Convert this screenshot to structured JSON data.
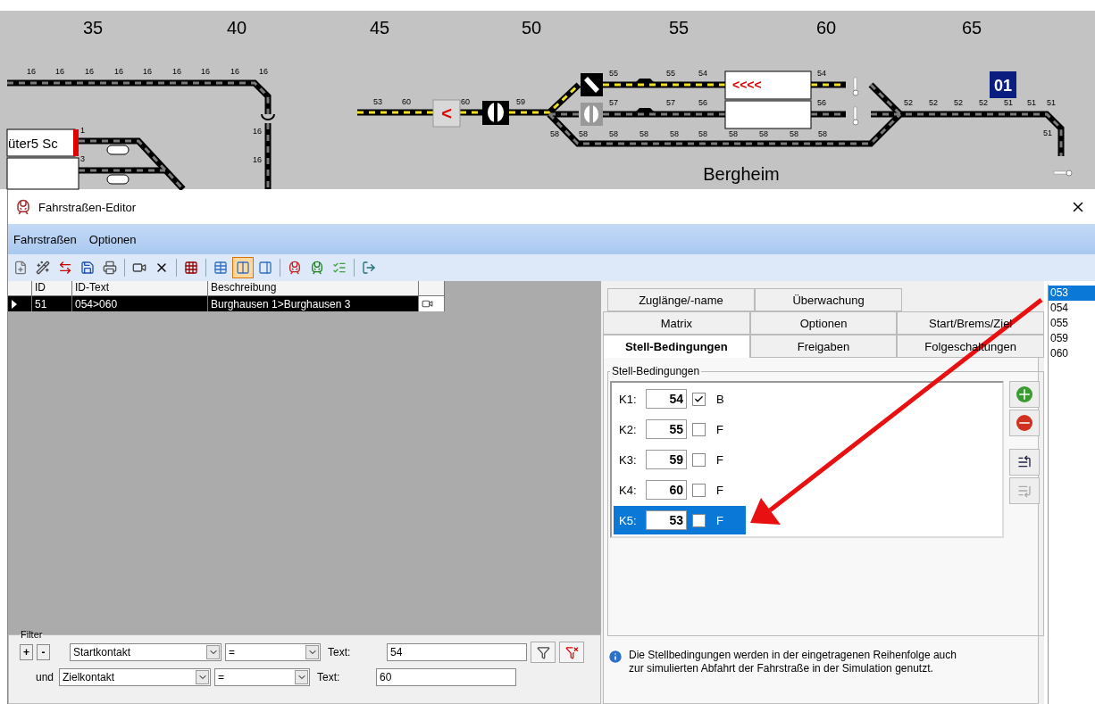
{
  "layout": {
    "column_numbers": [
      "35",
      "40",
      "45",
      "50",
      "55",
      "60",
      "65"
    ],
    "track_labels": [
      "16",
      "16",
      "16",
      "16",
      "16",
      "16",
      "16",
      "16",
      "16",
      "16",
      "16",
      "1",
      "3",
      "53",
      "60",
      "60",
      "59",
      "55",
      "55",
      "54",
      "54",
      "57",
      "57",
      "56",
      "56",
      "58",
      "58",
      "58",
      "58",
      "58",
      "58",
      "58",
      "58",
      "58",
      "58",
      "52",
      "52",
      "52",
      "52",
      "51",
      "51",
      "51",
      "51"
    ],
    "block_label": "üter5 Sc",
    "signal_button": "<",
    "route_arrows": "<<<<",
    "route_badge": "01",
    "station_name": "Bergheim"
  },
  "window": {
    "title": "Fahrstraßen-Editor"
  },
  "menu": [
    "Fahrstraßen",
    "Optionen"
  ],
  "toolbar": {
    "view_modes": [
      {
        "selected": false
      },
      {
        "selected": true
      },
      {
        "selected": false
      }
    ]
  },
  "table": {
    "columns": [
      "ID",
      "ID-Text",
      "Beschreibung"
    ],
    "rows": [
      {
        "id": "51",
        "id_text": "054>060",
        "description": "Burghausen 1>Burghausen 3",
        "selected": true
      }
    ]
  },
  "filter": {
    "title": "Filter",
    "rows": [
      {
        "kind": "first",
        "add": "+",
        "remove": "-",
        "field": "Startkontakt",
        "operator": "=",
        "text_label": "Text:",
        "value": "54"
      },
      {
        "kind": "and",
        "conjunction": "und",
        "field": "Zielkontakt",
        "operator": "=",
        "text_label": "Text:",
        "value": "60"
      }
    ]
  },
  "tabs": [
    [
      {
        "label": "Zuglänge/-name",
        "selected": false
      },
      {
        "label": "Überwachung",
        "selected": false
      }
    ],
    [
      {
        "label": "Matrix",
        "selected": false
      },
      {
        "label": "Optionen",
        "selected": false
      },
      {
        "label": "Start/Brems/Ziel",
        "selected": false
      }
    ],
    [
      {
        "label": "Stell-Bedingungen",
        "selected": true
      },
      {
        "label": "Freigaben",
        "selected": false
      },
      {
        "label": "Folgeschaltungen",
        "selected": false
      }
    ]
  ],
  "conditions": {
    "title": "Stell-Bedingungen",
    "rows": [
      {
        "label": "K1:",
        "value": "54",
        "checked": true,
        "flag": "B",
        "selected": false
      },
      {
        "label": "K2:",
        "value": "55",
        "checked": false,
        "flag": "F",
        "selected": false
      },
      {
        "label": "K3:",
        "value": "59",
        "checked": false,
        "flag": "F",
        "selected": false
      },
      {
        "label": "K4:",
        "value": "60",
        "checked": false,
        "flag": "F",
        "selected": false
      },
      {
        "label": "K5:",
        "value": "53",
        "checked": false,
        "flag": "F",
        "selected": true
      }
    ]
  },
  "info": "Die Stellbedingungen werden in der eingetragenen Reihenfolge auch\nzur simulierten Abfahrt der Fahrstraße in der Simulation genutzt.",
  "contacts": [
    {
      "label": "053",
      "selected": true
    },
    {
      "label": "054",
      "selected": false
    },
    {
      "label": "055",
      "selected": false
    },
    {
      "label": "059",
      "selected": false
    },
    {
      "label": "060",
      "selected": false
    }
  ]
}
